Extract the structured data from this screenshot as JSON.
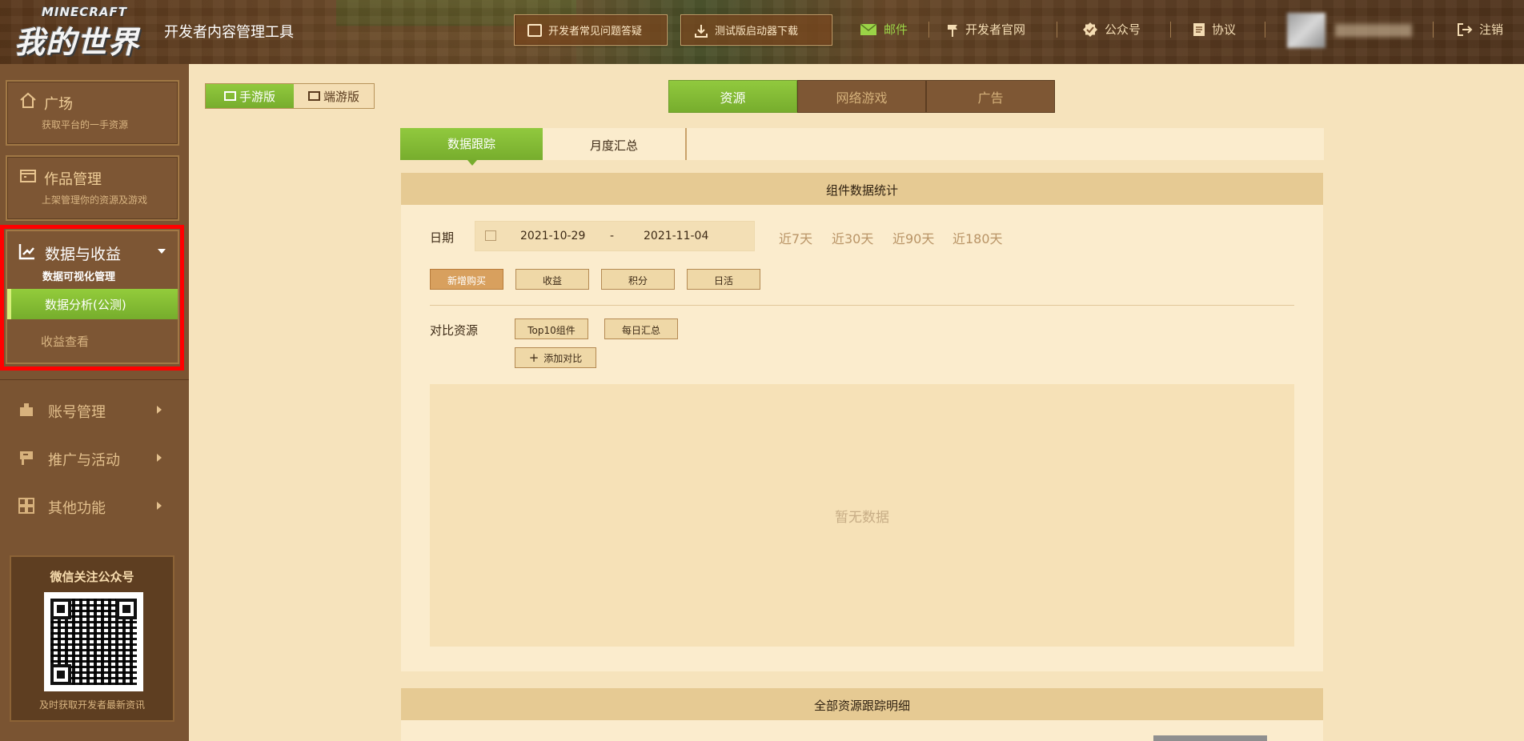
{
  "header": {
    "logo_top": "MINECRAFT",
    "logo_main": "我的世界",
    "app_title": "开发者内容管理工具",
    "faq_button": "开发者常见问题答疑",
    "download_button": "测试版启动器下载",
    "mail_link": "邮件",
    "official_site_link": "开发者官网",
    "official_account_link": "公众号",
    "agreement_link": "协议",
    "logout_link": "注销"
  },
  "sidebar": {
    "plaza": {
      "title": "广场",
      "sub": "获取平台的一手资源"
    },
    "works": {
      "title": "作品管理",
      "sub": "上架管理你的资源及游戏"
    },
    "data": {
      "title": "数据与收益",
      "sub": "数据可视化管理",
      "items": [
        "数据分析(公测)",
        "收益查看"
      ]
    },
    "nav": [
      "账号管理",
      "推广与活动",
      "其他功能"
    ],
    "wechat": {
      "title": "微信关注公众号",
      "caption": "及时获取开发者最新资讯"
    }
  },
  "platform_tabs": [
    "手游版",
    "端游版"
  ],
  "top_tabs": [
    "资源",
    "网络游戏",
    "广告"
  ],
  "sub_tabs": [
    "数据跟踪",
    "月度汇总"
  ],
  "stats": {
    "heading": "组件数据统计",
    "date_label": "日期",
    "start_date": "2021-10-29",
    "separator": "-",
    "end_date": "2021-11-04",
    "quick_ranges": [
      "近7天",
      "近30天",
      "近90天",
      "近180天"
    ],
    "metrics": [
      "新增购买",
      "收益",
      "积分",
      "日活"
    ],
    "compare_label": "对比资源",
    "compare_options": [
      "Top10组件",
      "每日汇总"
    ],
    "add_compare": "添加对比",
    "empty_text": "暂无数据"
  },
  "detail": {
    "heading": "全部资源跟踪明细"
  },
  "colors": {
    "accent_green": "#86bd35",
    "sidebar_brown": "#7a5432",
    "page_bg": "#f6e3bc",
    "highlight_red": "#ff0000"
  }
}
